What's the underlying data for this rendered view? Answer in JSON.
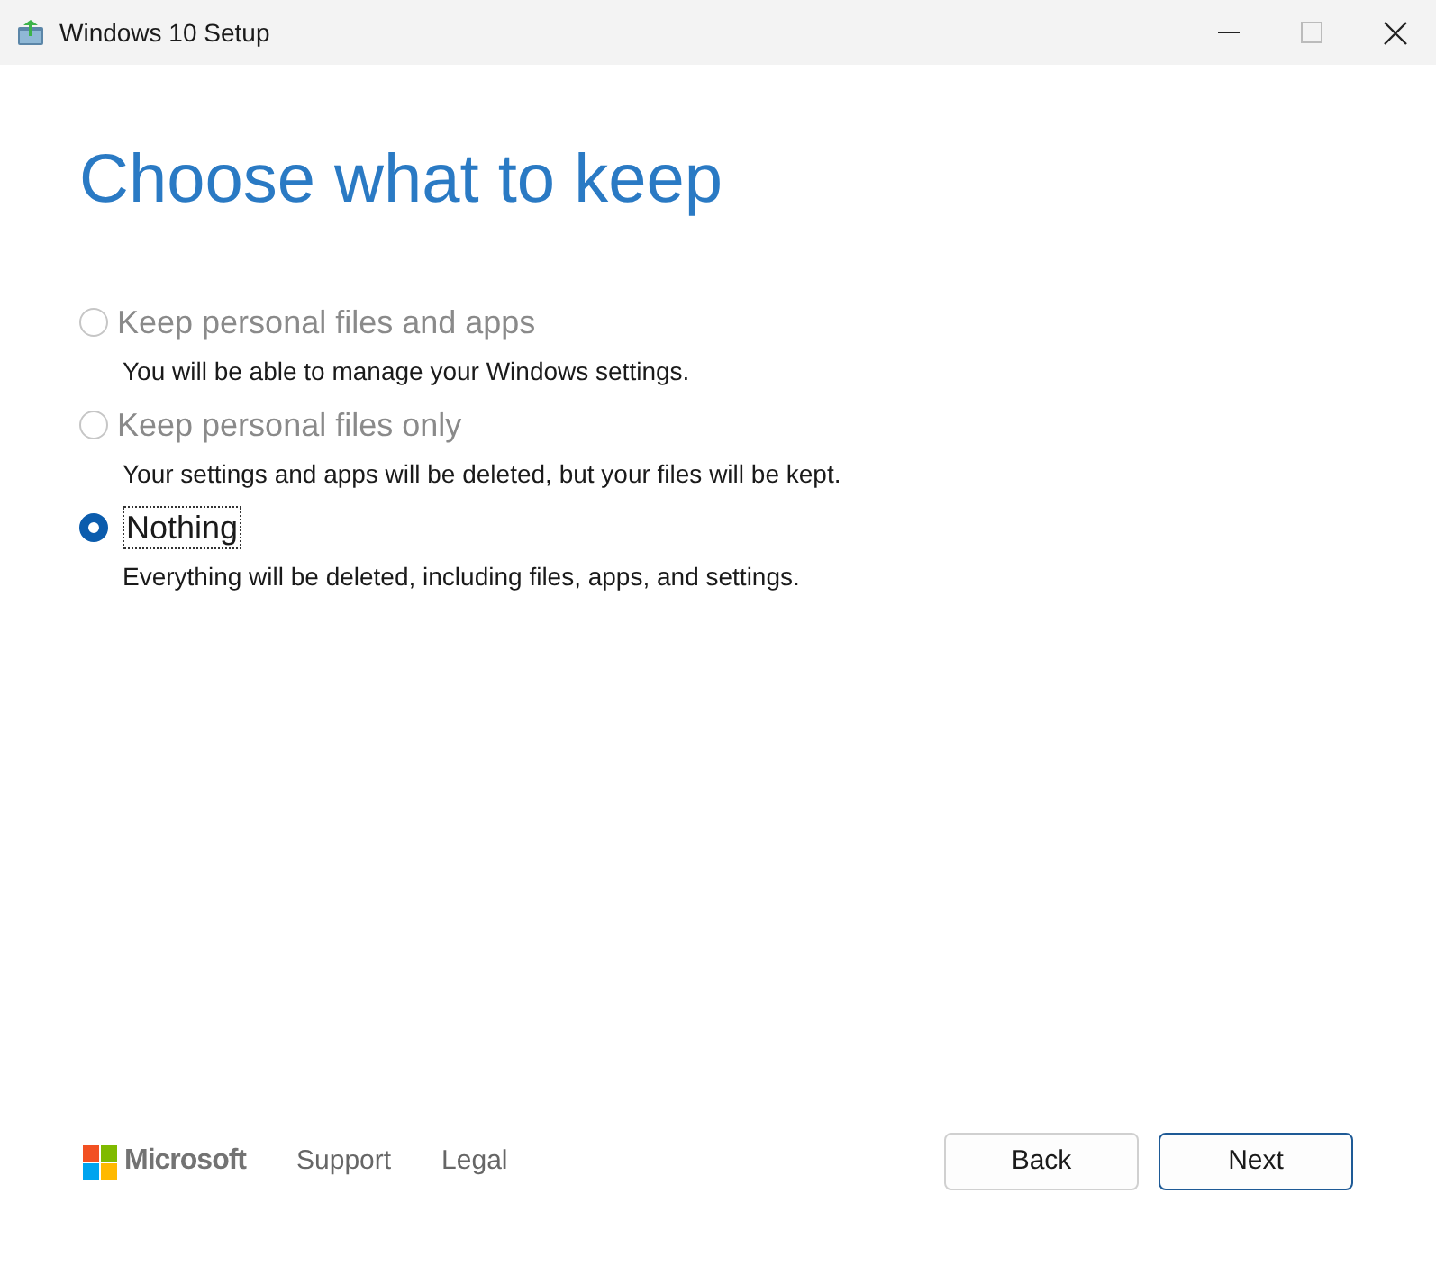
{
  "window": {
    "title": "Windows 10 Setup"
  },
  "heading": "Choose what to keep",
  "options": [
    {
      "label": "Keep personal files and apps",
      "description": "You will be able to manage your Windows settings.",
      "selected": false,
      "disabled": true,
      "focused": false
    },
    {
      "label": "Keep personal files only",
      "description": "Your settings and apps will be deleted, but your files will be kept.",
      "selected": false,
      "disabled": true,
      "focused": false
    },
    {
      "label": "Nothing",
      "description": "Everything will be deleted, including files, apps, and settings.",
      "selected": true,
      "disabled": false,
      "focused": true
    }
  ],
  "footer": {
    "brand": "Microsoft",
    "links": [
      "Support",
      "Legal"
    ]
  },
  "buttons": [
    {
      "label": "Back",
      "default": false
    },
    {
      "label": "Next",
      "default": true
    }
  ]
}
